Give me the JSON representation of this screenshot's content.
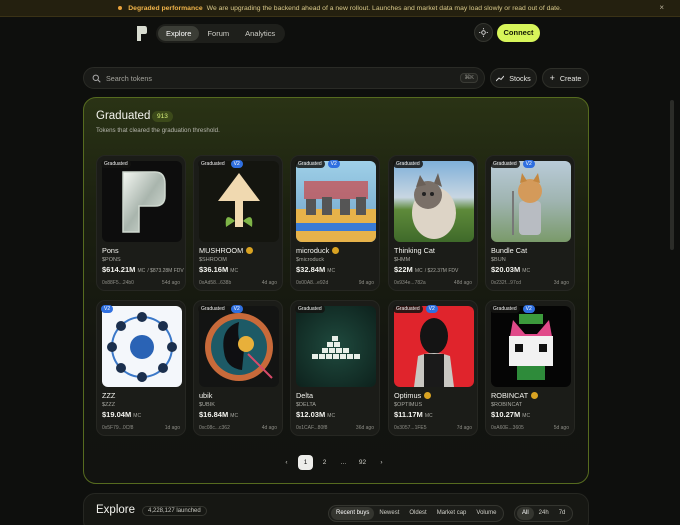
{
  "banner": {
    "title": "Degraded performance",
    "message": "We are upgrading the backend ahead of a new rollout. Launches and market data may load slowly or read out of date.",
    "close": "×"
  },
  "nav": {
    "tabs": [
      "Explore",
      "Forum",
      "Analytics"
    ],
    "connect": "Connect"
  },
  "search": {
    "placeholder": "Search tokens",
    "shortcut": "⌘K"
  },
  "actions": {
    "stocks": "Stocks",
    "create": "Create"
  },
  "graduated": {
    "title": "Graduated",
    "count": "913",
    "subtitle": "Tokens that cleared the graduation threshold.",
    "cards": [
      {
        "name": "Pons",
        "ticker": "$PONS",
        "mc": "$614.21M",
        "mc_unit": "MC",
        "fdv": "/ $873.28M FDV",
        "addr": "0x88F5...24b0",
        "ago": "54d ago",
        "graduated": "Graduated",
        "v2": "",
        "coin": false
      },
      {
        "name": "MUSHROOM",
        "ticker": "$SHROOM",
        "mc": "$36.16M",
        "mc_unit": "MC",
        "fdv": "",
        "addr": "0xAd58...638b",
        "ago": "4d ago",
        "graduated": "Graduated",
        "v2": "V2",
        "coin": true
      },
      {
        "name": "microduck",
        "ticker": "$microduck",
        "mc": "$32.84M",
        "mc_unit": "MC",
        "fdv": "",
        "addr": "0x00A8...e92d",
        "ago": "9d ago",
        "graduated": "Graduated",
        "v2": "V2",
        "coin": true
      },
      {
        "name": "Thinking Cat",
        "ticker": "$HMM",
        "mc": "$22M",
        "mc_unit": "MC",
        "fdv": "/ $22.37M FDV",
        "addr": "0x934e...782a",
        "ago": "48d ago",
        "graduated": "Graduated",
        "v2": "",
        "coin": false
      },
      {
        "name": "Bundle Cat",
        "ticker": "$BUN",
        "mc": "$20.03M",
        "mc_unit": "MC",
        "fdv": "",
        "addr": "0x232f...97cd",
        "ago": "3d ago",
        "graduated": "Graduated",
        "v2": "V2",
        "coin": false
      },
      {
        "name": "ZZZ",
        "ticker": "$ZZZ",
        "mc": "$19.04M",
        "mc_unit": "MC",
        "fdv": "",
        "addr": "0x5F79...0Cf8",
        "ago": "1d ago",
        "graduated": "",
        "v2": "V2",
        "coin": false
      },
      {
        "name": "ubik",
        "ticker": "$UBIK",
        "mc": "$16.84M",
        "mc_unit": "MC",
        "fdv": "",
        "addr": "0xc08c...c362",
        "ago": "4d ago",
        "graduated": "Graduated",
        "v2": "V2",
        "coin": false
      },
      {
        "name": "Delta",
        "ticker": "$DELTA",
        "mc": "$12.03M",
        "mc_unit": "MC",
        "fdv": "",
        "addr": "0x1CAF...80f8",
        "ago": "36d ago",
        "graduated": "Graduated",
        "v2": "",
        "coin": false
      },
      {
        "name": "Optimus",
        "ticker": "$OPTIMUS",
        "mc": "$11.17M",
        "mc_unit": "MC",
        "fdv": "",
        "addr": "0x3057...1FE5",
        "ago": "7d ago",
        "graduated": "Graduated",
        "v2": "V2",
        "coin": true
      },
      {
        "name": "ROBINCAT",
        "ticker": "$ROBINCAT",
        "mc": "$10.27M",
        "mc_unit": "MC",
        "fdv": "",
        "addr": "0xA60E...3605",
        "ago": "5d ago",
        "graduated": "Graduated",
        "v2": "V2",
        "coin": true
      }
    ]
  },
  "pagination": {
    "prev": "‹",
    "pages": [
      "1",
      "2",
      "...",
      "92"
    ],
    "next": "›"
  },
  "explore": {
    "title": "Explore",
    "count": "4,228,127 launched",
    "filters": [
      "Recent buys",
      "Newest",
      "Oldest",
      "Market cap",
      "Volume"
    ],
    "ranges": [
      "All",
      "24h",
      "7d"
    ]
  },
  "colors": {
    "accent": "#d7f55a",
    "v2_badge": "#2f6fe0",
    "warning": "#f0b44a"
  }
}
